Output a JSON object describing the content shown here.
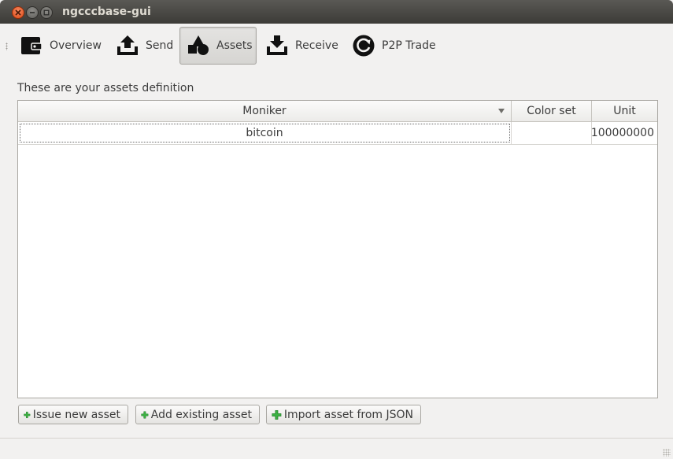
{
  "window": {
    "title": "ngcccbase-gui"
  },
  "toolbar": {
    "items": [
      {
        "label": "Overview",
        "icon": "wallet-icon",
        "active": false
      },
      {
        "label": "Send",
        "icon": "upload-tray-icon",
        "active": false
      },
      {
        "label": "Assets",
        "icon": "shapes-icon",
        "active": true
      },
      {
        "label": "Receive",
        "icon": "download-tray-icon",
        "active": false
      },
      {
        "label": "P2P Trade",
        "icon": "sync-circle-icon",
        "active": false
      }
    ]
  },
  "assets": {
    "description": "These are your assets definition",
    "columns": [
      "Moniker",
      "Color set",
      "Unit"
    ],
    "sort_indicator": "descending",
    "rows": [
      {
        "moniker": "bitcoin",
        "color_set": "",
        "unit": "100000000"
      }
    ]
  },
  "actions": {
    "issue_label": "Issue new asset",
    "add_label": "Add existing asset",
    "import_label": "Import asset from JSON",
    "icon": "green-plus-icon"
  },
  "colors": {
    "titlebar": "#3c3b37",
    "close_button": "#df4a16",
    "window_bg": "#f2f1f0",
    "plus_green": "#3cb043"
  }
}
